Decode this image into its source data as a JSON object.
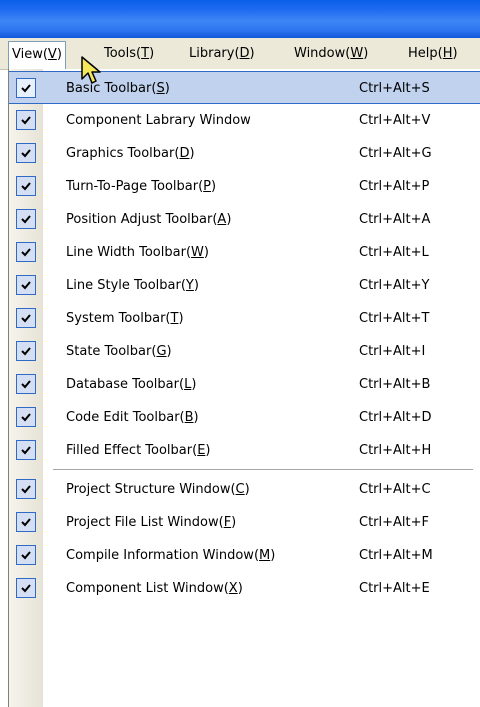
{
  "menubar": {
    "items": [
      {
        "before": "View(",
        "mnemonic": "V",
        "after": ")",
        "active": true
      },
      {
        "before": "Tools(",
        "mnemonic": "T",
        "after": ")"
      },
      {
        "before": "Library(",
        "mnemonic": "D",
        "after": ")"
      },
      {
        "before": "Window(",
        "mnemonic": "W",
        "after": ")"
      },
      {
        "before": "Help(",
        "mnemonic": "H",
        "after": ")"
      }
    ]
  },
  "view_menu": {
    "items": [
      {
        "before": "Basic Toolbar(",
        "mnemonic": "S",
        "after": ")",
        "shortcut": "Ctrl+Alt+S",
        "checked": true,
        "highlighted": true
      },
      {
        "before": "Component Labrary Window",
        "mnemonic": "",
        "after": "",
        "shortcut": "Ctrl+Alt+V",
        "checked": true
      },
      {
        "before": "Graphics Toolbar(",
        "mnemonic": "D",
        "after": ")",
        "shortcut": "Ctrl+Alt+G",
        "checked": true
      },
      {
        "before": "Turn-To-Page Toolbar(",
        "mnemonic": "P",
        "after": ")",
        "shortcut": "Ctrl+Alt+P",
        "checked": true
      },
      {
        "before": "Position Adjust Toolbar(",
        "mnemonic": "A",
        "after": ")",
        "shortcut": "Ctrl+Alt+A",
        "checked": true
      },
      {
        "before": "Line Width Toolbar(",
        "mnemonic": "W",
        "after": ")",
        "shortcut": "Ctrl+Alt+L",
        "checked": true
      },
      {
        "before": "Line Style Toolbar(",
        "mnemonic": "Y",
        "after": ")",
        "shortcut": "Ctrl+Alt+Y",
        "checked": true
      },
      {
        "before": "System Toolbar(",
        "mnemonic": "T",
        "after": ")",
        "shortcut": "Ctrl+Alt+T",
        "checked": true
      },
      {
        "before": "State Toolbar(",
        "mnemonic": "G",
        "after": ")",
        "shortcut": "Ctrl+Alt+I",
        "checked": true
      },
      {
        "before": "Database Toolbar(",
        "mnemonic": "L",
        "after": ")",
        "shortcut": "Ctrl+Alt+B",
        "checked": true
      },
      {
        "before": "Code Edit Toolbar(",
        "mnemonic": "B",
        "after": ")",
        "shortcut": "Ctrl+Alt+D",
        "checked": true
      },
      {
        "before": "Filled Effect Toolbar(",
        "mnemonic": "E",
        "after": ")",
        "shortcut": "Ctrl+Alt+H",
        "checked": true
      },
      {
        "before": "Project Structure Window(",
        "mnemonic": "C",
        "after": ")",
        "shortcut": "Ctrl+Alt+C",
        "checked": true
      },
      {
        "before": "Project File List Window(",
        "mnemonic": "F",
        "after": ")",
        "shortcut": "Ctrl+Alt+F",
        "checked": true
      },
      {
        "before": "Compile Information Window(",
        "mnemonic": "M",
        "after": ")",
        "shortcut": "Ctrl+Alt+M",
        "checked": true
      },
      {
        "before": "Component List Window(",
        "mnemonic": "X",
        "after": ")",
        "shortcut": "Ctrl+Alt+E",
        "checked": true
      }
    ]
  },
  "colors": {
    "title_bar": "#1f6af0",
    "menu_bar": "#ece9d8",
    "highlight": "#c1d2ee",
    "highlight_border": "#316ac5",
    "check_box": "#d4dff4"
  },
  "icons": {
    "check": "check-icon",
    "cursor": "mouse-pointer-icon"
  }
}
